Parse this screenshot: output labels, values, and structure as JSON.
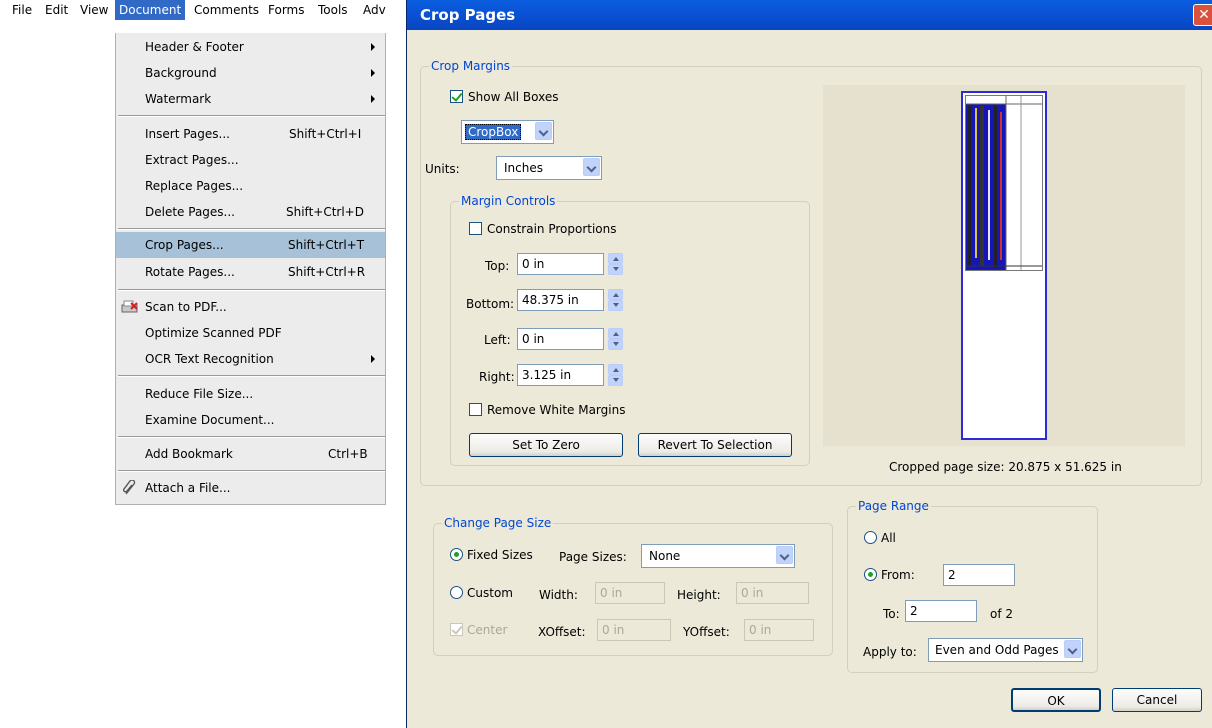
{
  "menubar": {
    "items": [
      "File",
      "Edit",
      "View",
      "Document",
      "Comments",
      "Forms",
      "Tools",
      "Adv"
    ],
    "active": "Document"
  },
  "menu": {
    "items": [
      {
        "label": "Header & Footer",
        "submenu": true
      },
      {
        "label": "Background",
        "submenu": true
      },
      {
        "label": "Watermark",
        "submenu": true
      },
      {
        "label": "Insert Pages...",
        "shortcut": "Shift+Ctrl+I"
      },
      {
        "label": "Extract Pages..."
      },
      {
        "label": "Replace Pages..."
      },
      {
        "label": "Delete Pages...",
        "shortcut": "Shift+Ctrl+D"
      },
      {
        "label": "Crop Pages...",
        "shortcut": "Shift+Ctrl+T",
        "highlighted": true
      },
      {
        "label": "Rotate Pages...",
        "shortcut": "Shift+Ctrl+R"
      },
      {
        "label": "Scan to PDF...",
        "icon": "scanner-icon"
      },
      {
        "label": "Optimize Scanned PDF"
      },
      {
        "label": "OCR Text Recognition",
        "submenu": true
      },
      {
        "label": "Reduce File Size..."
      },
      {
        "label": "Examine Document..."
      },
      {
        "label": "Add Bookmark",
        "shortcut": "Ctrl+B"
      },
      {
        "label": "Attach a File...",
        "icon": "paperclip-icon"
      }
    ]
  },
  "dialog": {
    "title": "Crop Pages",
    "close_glyph": "✕",
    "crop_margins": {
      "legend": "Crop Margins",
      "show_all_boxes": {
        "label": "Show All Boxes",
        "checked": true
      },
      "box_select": "CropBox",
      "units_label": "Units:",
      "units_value": "Inches",
      "margin_controls": {
        "legend": "Margin Controls",
        "constrain": {
          "label": "Constrain Proportions",
          "checked": false
        },
        "top": {
          "label": "Top:",
          "value": "0 in"
        },
        "bottom": {
          "label": "Bottom:",
          "value": "48.375 in"
        },
        "left": {
          "label": "Left:",
          "value": "0 in"
        },
        "right": {
          "label": "Right:",
          "value": "3.125 in"
        },
        "remove_white": {
          "label": "Remove White Margins",
          "checked": false
        },
        "set_to_zero": "Set To Zero",
        "revert": "Revert To Selection"
      },
      "cropped_size": "Cropped page size: 20.875 x 51.625 in"
    },
    "change_page_size": {
      "legend": "Change Page Size",
      "fixed_sizes": {
        "label": "Fixed Sizes",
        "selected": true
      },
      "page_sizes_label": "Page Sizes:",
      "page_sizes_value": "None",
      "custom": {
        "label": "Custom",
        "selected": false
      },
      "width_label": "Width:",
      "width_value": "0 in",
      "height_label": "Height:",
      "height_value": "0 in",
      "center": {
        "label": "Center",
        "checked": true,
        "disabled": true
      },
      "xoffset_label": "XOffset:",
      "xoffset_value": "0 in",
      "yoffset_label": "YOffset:",
      "yoffset_value": "0 in"
    },
    "page_range": {
      "legend": "Page Range",
      "all": {
        "label": "All",
        "selected": false
      },
      "from": {
        "label": "From:",
        "selected": true,
        "value": "2"
      },
      "to_label": "To:",
      "to_value": "2",
      "of_label": "of 2",
      "apply_label": "Apply to:",
      "apply_value": "Even and Odd Pages"
    },
    "ok": "OK",
    "cancel": "Cancel"
  }
}
